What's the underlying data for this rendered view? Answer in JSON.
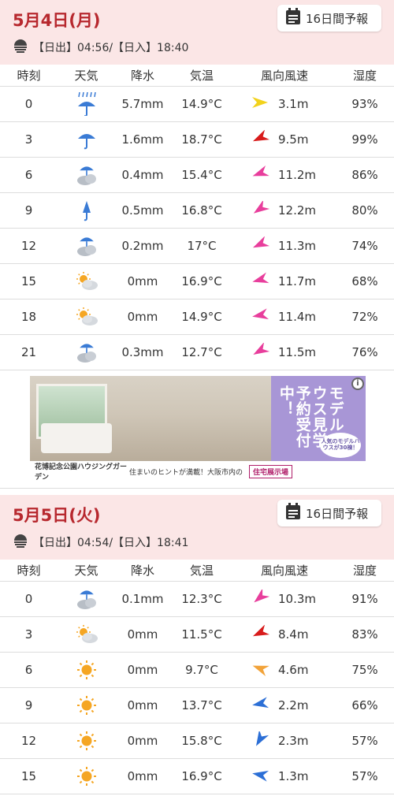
{
  "columns": [
    "時刻",
    "天気",
    "降水",
    "気温",
    "風向風速",
    "湿度"
  ],
  "forecast_button": "16日間予報",
  "days": [
    {
      "date": "5月4日(月)",
      "sun": "【日出】04:56/【日入】18:40",
      "rows": [
        {
          "hour": "0",
          "weather": "rain-heavy",
          "precip": "5.7mm",
          "temp": "14.9°C",
          "wind_dir": "yellow",
          "wind": "3.1m",
          "humidity": "93%"
        },
        {
          "hour": "3",
          "weather": "rain",
          "precip": "1.6mm",
          "temp": "18.7°C",
          "wind_dir": "red",
          "wind": "9.5m",
          "humidity": "99%"
        },
        {
          "hour": "6",
          "weather": "cloud-rain",
          "precip": "0.4mm",
          "temp": "15.4°C",
          "wind_dir": "pink",
          "wind": "11.2m",
          "humidity": "86%"
        },
        {
          "hour": "9",
          "weather": "rain-closed",
          "precip": "0.5mm",
          "temp": "16.8°C",
          "wind_dir": "pink",
          "wind": "12.2m",
          "humidity": "80%"
        },
        {
          "hour": "12",
          "weather": "cloud-rain",
          "precip": "0.2mm",
          "temp": "17°C",
          "wind_dir": "pink",
          "wind": "11.3m",
          "humidity": "74%"
        },
        {
          "hour": "15",
          "weather": "sun-cloud",
          "precip": "0mm",
          "temp": "16.9°C",
          "wind_dir": "pink",
          "wind": "11.7m",
          "humidity": "68%"
        },
        {
          "hour": "18",
          "weather": "sun-cloud",
          "precip": "0mm",
          "temp": "14.9°C",
          "wind_dir": "pink",
          "wind": "11.4m",
          "humidity": "72%"
        },
        {
          "hour": "21",
          "weather": "cloud-rain",
          "precip": "0.3mm",
          "temp": "12.7°C",
          "wind_dir": "pink",
          "wind": "11.5m",
          "humidity": "76%"
        }
      ]
    },
    {
      "date": "5月5日(火)",
      "sun": "【日出】04:54/【日入】18:41",
      "rows": [
        {
          "hour": "0",
          "weather": "cloud-rain",
          "precip": "0.1mm",
          "temp": "12.3°C",
          "wind_dir": "pink",
          "wind": "10.3m",
          "humidity": "91%"
        },
        {
          "hour": "3",
          "weather": "sun-cloud",
          "precip": "0mm",
          "temp": "11.5°C",
          "wind_dir": "red",
          "wind": "8.4m",
          "humidity": "83%"
        },
        {
          "hour": "6",
          "weather": "sun",
          "precip": "0mm",
          "temp": "9.7°C",
          "wind_dir": "orange",
          "wind": "4.6m",
          "humidity": "75%"
        },
        {
          "hour": "9",
          "weather": "sun",
          "precip": "0mm",
          "temp": "13.7°C",
          "wind_dir": "blue",
          "wind": "2.2m",
          "humidity": "66%"
        },
        {
          "hour": "12",
          "weather": "sun",
          "precip": "0mm",
          "temp": "15.8°C",
          "wind_dir": "blue",
          "wind": "2.3m",
          "humidity": "57%"
        },
        {
          "hour": "15",
          "weather": "sun",
          "precip": "0mm",
          "temp": "16.9°C",
          "wind_dir": "blue",
          "wind": "1.3m",
          "humidity": "57%"
        }
      ]
    }
  ],
  "ad": {
    "copy": "モデルハウス見学予約受付中！",
    "badge": "人気のモデルハウスが30棟！",
    "brand": "花博記念公園ハウジングガーデン",
    "tagline": "住まいのヒントが満載！大阪市内の",
    "tag": "住宅展示場",
    "info": "i"
  },
  "colors": {
    "header_bg": "#fbe6e6",
    "date": "#b7282e",
    "rain_blue": "#3a7bd5",
    "sun_orange": "#f5a623",
    "wind_pink": "#e83e9c",
    "wind_red": "#d81b1b",
    "wind_yellow": "#f2d21b",
    "wind_orange": "#f2a33a",
    "wind_blue": "#2c6fd6"
  }
}
